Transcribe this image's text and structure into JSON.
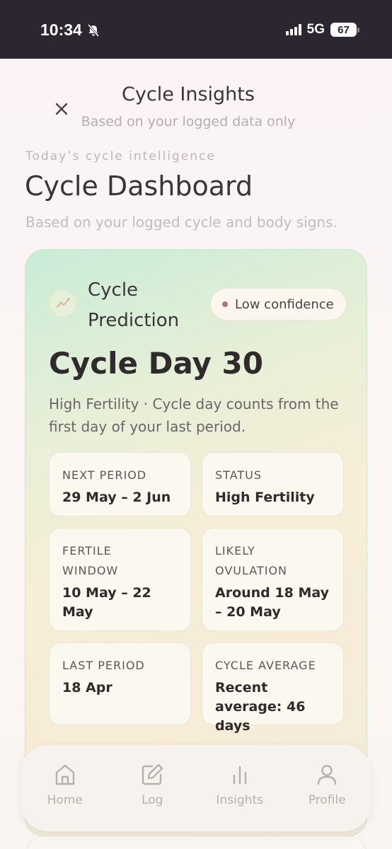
{
  "status_bar": {
    "time": "10:34",
    "network": "5G",
    "battery": "67"
  },
  "header": {
    "title": "Cycle Insights",
    "subtitle": "Based on your logged data only"
  },
  "dashboard": {
    "eyebrow": "Today’s cycle intelligence",
    "title": "Cycle Dashboard",
    "subtitle": "Based on your logged cycle and body signs."
  },
  "prediction_card": {
    "title": "Cycle Prediction",
    "confidence": "Low confidence",
    "cycle_day": "Cycle Day 30",
    "description": "High Fertility · Cycle day counts from the first day of your last period.",
    "tiles": [
      {
        "label": "Next period",
        "value": "29 May – 2 Jun"
      },
      {
        "label": "Status",
        "value": "High Fertility"
      },
      {
        "label": "Fertile window",
        "value": "10 May – 22 May"
      },
      {
        "label": "Likely ovulation",
        "value": "Around 18 May – 20 May"
      },
      {
        "label": "Last period",
        "value": "18 Apr"
      },
      {
        "label": "Cycle average",
        "value": "Recent average: 46 days"
      }
    ]
  },
  "nav": {
    "items": [
      {
        "label": "Home",
        "icon": "home-icon"
      },
      {
        "label": "Log",
        "icon": "edit-icon"
      },
      {
        "label": "Insights",
        "icon": "bar-chart-icon"
      },
      {
        "label": "Profile",
        "icon": "user-icon"
      }
    ]
  }
}
